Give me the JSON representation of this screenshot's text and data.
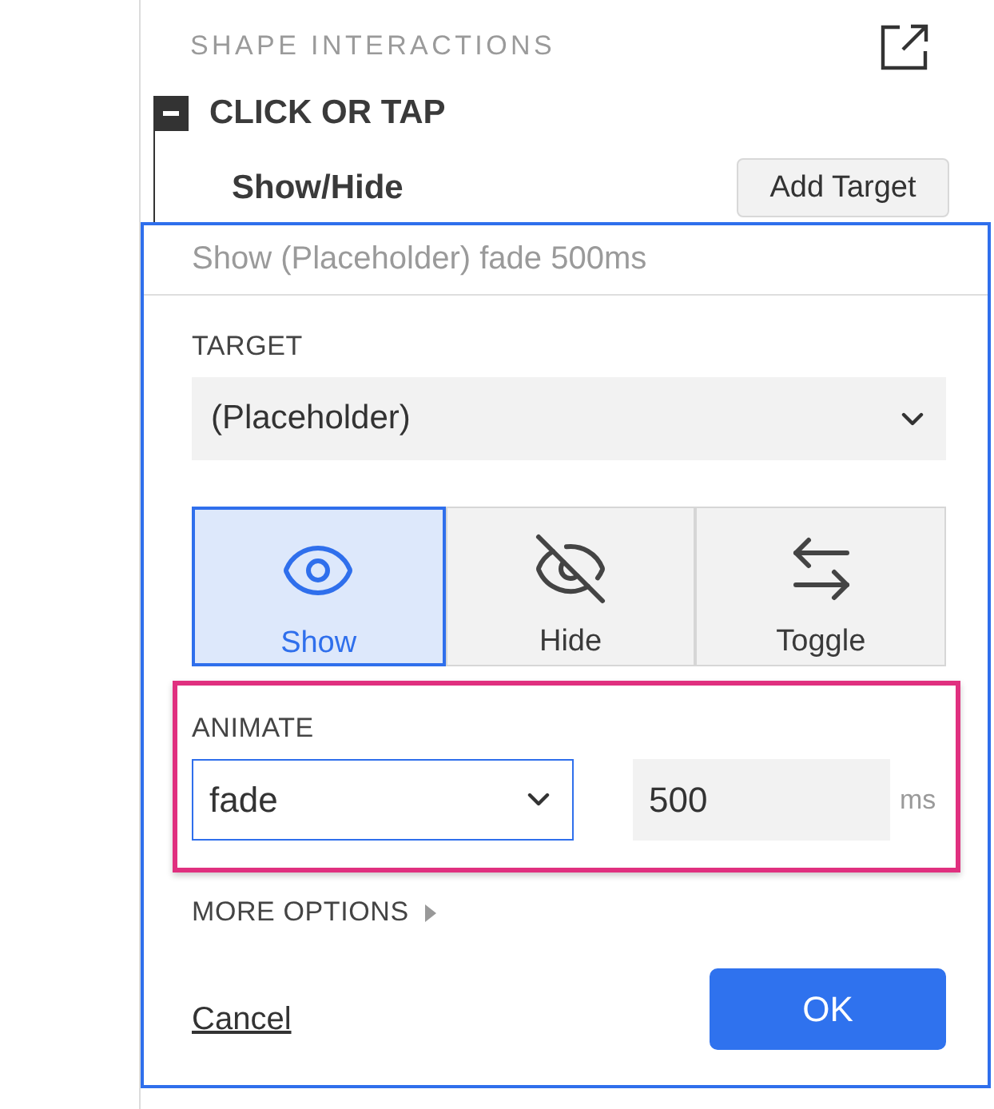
{
  "panel": {
    "title": "SHAPE INTERACTIONS"
  },
  "trigger": {
    "label": "CLICK OR TAP",
    "expanded": true
  },
  "action": {
    "title": "Show/Hide",
    "add_button": "Add Target"
  },
  "editor": {
    "summary": "Show (Placeholder) fade 500ms",
    "target_label": "TARGET",
    "target_value": "(Placeholder)",
    "modes": [
      {
        "label": "Show",
        "kind": "show",
        "selected": true
      },
      {
        "label": "Hide",
        "kind": "hide",
        "selected": false
      },
      {
        "label": "Toggle",
        "kind": "toggle",
        "selected": false
      }
    ],
    "animate": {
      "label": "ANIMATE",
      "effect": "fade",
      "duration": "500",
      "unit": "ms",
      "highlighted": true
    },
    "more_options": "MORE OPTIONS",
    "cancel": "Cancel",
    "ok": "OK"
  }
}
